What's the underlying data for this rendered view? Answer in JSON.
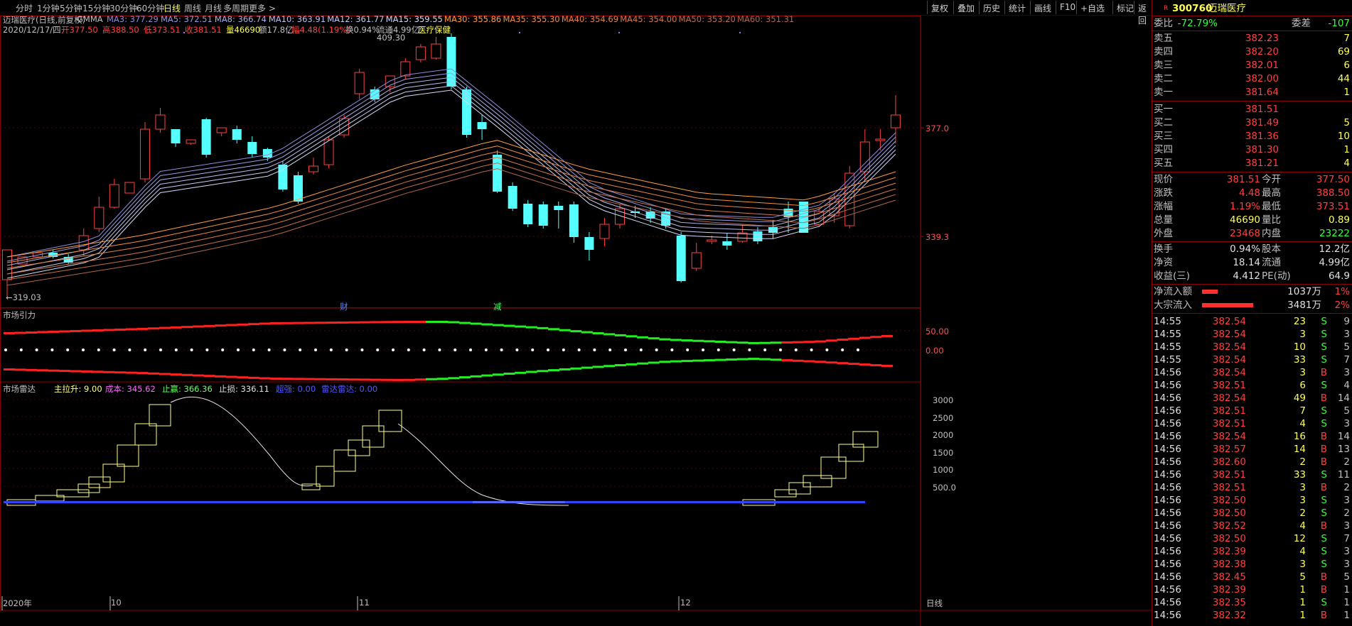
{
  "toolbar": {
    "timeframes": [
      "分时",
      "1分钟",
      "5分钟",
      "15分钟",
      "30分钟",
      "60分钟",
      "日线",
      "周线",
      "月线",
      "多周期",
      "更多 >"
    ],
    "active_timeframe": "日线",
    "right_buttons": [
      "复权",
      "叠加",
      "历史",
      "统计",
      "画线",
      "F10",
      "+自选",
      "标记",
      "返回"
    ]
  },
  "kline": {
    "title": "迈瑞医疗(日线,前复权)",
    "gmma_label": "GMMA",
    "ma": [
      {
        "label": "MA3: 377.29",
        "color": "#8b8bd8"
      },
      {
        "label": "MA5: 372.51",
        "color": "#9a9ae0"
      },
      {
        "label": "MA8: 366.74",
        "color": "#aab0e8"
      },
      {
        "label": "MA10: 363.91",
        "color": "#b8c0ee"
      },
      {
        "label": "MA12: 361.77",
        "color": "#c4ccf2"
      },
      {
        "label": "MA15: 359.55",
        "color": "#d4daf8"
      },
      {
        "label": "MA30: 355.86",
        "color": "#ff9e3d"
      },
      {
        "label": "MA35: 355.30",
        "color": "#f09040"
      },
      {
        "label": "MA40: 354.69",
        "color": "#e08545"
      },
      {
        "label": "MA45: 354.00",
        "color": "#d07a48"
      },
      {
        "label": "MA50: 353.20",
        "color": "#c0704a"
      },
      {
        "label": "MA60: 351.31",
        "color": "#b0664c"
      }
    ],
    "info": [
      {
        "t": "2020/12/17/四",
        "c": "#c0c0c0"
      },
      {
        "t": "开377.50",
        "c": "#ff4040"
      },
      {
        "t": "高388.50",
        "c": "#ff4040"
      },
      {
        "t": "低373.51",
        "c": "#ff4040"
      },
      {
        "t": "收381.51",
        "c": "#ff4040"
      },
      {
        "t": "量46690",
        "c": "#ffff55"
      },
      {
        "t": "额17.8亿",
        "c": "#c0c0c0"
      },
      {
        "t": "幅4.48(1.19%)",
        "c": "#ff4040"
      },
      {
        "t": "换0.94%",
        "c": "#c0c0c0"
      },
      {
        "t": "流通4.99亿",
        "c": "#c0c0c0"
      },
      {
        "t": "医疗保健",
        "c": "#ffff55"
      }
    ],
    "y_labels": [
      "377.0",
      "339.3"
    ],
    "high_mark": "409.30",
    "low_mark": "←319.03",
    "event_marks": [
      "财",
      "减"
    ],
    "x_labels": [
      "2020年",
      "10",
      "11",
      "12"
    ],
    "period_label": "日线"
  },
  "panel2": {
    "title": "市场引力",
    "y_labels": [
      "50.00",
      "0.00"
    ]
  },
  "panel3": {
    "title": "市场雷达",
    "legend": [
      {
        "t": "主拉升: 9.00",
        "c": "#ffff88"
      },
      {
        "t": "成本: 345.62",
        "c": "#ff66ff"
      },
      {
        "t": "止赢: 366.36",
        "c": "#66ff66"
      },
      {
        "t": "止损: 336.11",
        "c": "#e0e0e0"
      },
      {
        "t": "超强: 0.00",
        "c": "#5555ff"
      },
      {
        "t": "雷达雷达: 0.00",
        "c": "#5555ff"
      }
    ],
    "y_labels": [
      "3000",
      "2500",
      "2000",
      "1500",
      "1000",
      "500.0"
    ]
  },
  "quote": {
    "code": "300760",
    "name": "迈瑞医疗",
    "badge": "R",
    "weibi_label": "委比",
    "weibi": "-72.79%",
    "weicha_label": "委差",
    "weicha": "-107",
    "sells": [
      {
        "l": "卖五",
        "p": "382.23",
        "v": "7"
      },
      {
        "l": "卖四",
        "p": "382.20",
        "v": "69"
      },
      {
        "l": "卖三",
        "p": "382.01",
        "v": "6"
      },
      {
        "l": "卖二",
        "p": "382.00",
        "v": "44"
      },
      {
        "l": "卖一",
        "p": "381.64",
        "v": "1"
      }
    ],
    "buys": [
      {
        "l": "买一",
        "p": "381.51",
        "v": ""
      },
      {
        "l": "买二",
        "p": "381.49",
        "v": "5"
      },
      {
        "l": "买三",
        "p": "381.36",
        "v": "10"
      },
      {
        "l": "买四",
        "p": "381.30",
        "v": "1"
      },
      {
        "l": "买五",
        "p": "381.21",
        "v": "4"
      }
    ],
    "stats": [
      {
        "l1": "现价",
        "v1": "381.51",
        "c1": "#ff4040",
        "l2": "今开",
        "v2": "377.50",
        "c2": "#ff4040"
      },
      {
        "l1": "涨跌",
        "v1": "4.48",
        "c1": "#ff4040",
        "l2": "最高",
        "v2": "388.50",
        "c2": "#ff4040"
      },
      {
        "l1": "涨幅",
        "v1": "1.19%",
        "c1": "#ff4040",
        "l2": "最低",
        "v2": "373.51",
        "c2": "#ff4040"
      },
      {
        "l1": "总量",
        "v1": "46690",
        "c1": "#ffff55",
        "l2": "量比",
        "v2": "0.89",
        "c2": "#ffff55"
      },
      {
        "l1": "外盘",
        "v1": "23468",
        "c1": "#ff4040",
        "l2": "内盘",
        "v2": "23222",
        "c2": "#33ff33"
      }
    ],
    "stats2": [
      {
        "l1": "换手",
        "v1": "0.94%",
        "c1": "#e0e0e0",
        "l2": "股本",
        "v2": "12.2亿",
        "c2": "#e0e0e0"
      },
      {
        "l1": "净资",
        "v1": "18.14",
        "c1": "#e0e0e0",
        "l2": "流通",
        "v2": "4.99亿",
        "c2": "#e0e0e0"
      },
      {
        "l1": "收益(三)",
        "v1": "4.412",
        "c1": "#e0e0e0",
        "l2": "PE(动)",
        "v2": "64.9",
        "c2": "#e0e0e0"
      }
    ],
    "flows": [
      {
        "l": "净流入额",
        "v": "1037万",
        "p": "1%",
        "bar": 0.18
      },
      {
        "l": "大宗流入",
        "v": "3481万",
        "p": "2%",
        "bar": 0.6
      }
    ],
    "ticks": [
      {
        "t": "14:55",
        "p": "382.54",
        "v": "23",
        "d": "S",
        "n": "9"
      },
      {
        "t": "14:55",
        "p": "382.54",
        "v": "3",
        "d": "S",
        "n": "3"
      },
      {
        "t": "14:55",
        "p": "382.54",
        "v": "10",
        "d": "S",
        "n": "5"
      },
      {
        "t": "14:55",
        "p": "382.54",
        "v": "33",
        "d": "S",
        "n": "7"
      },
      {
        "t": "14:56",
        "p": "382.54",
        "v": "3",
        "d": "B",
        "n": "3"
      },
      {
        "t": "14:56",
        "p": "382.51",
        "v": "6",
        "d": "S",
        "n": "4"
      },
      {
        "t": "14:56",
        "p": "382.54",
        "v": "49",
        "d": "B",
        "n": "14"
      },
      {
        "t": "14:56",
        "p": "382.51",
        "v": "7",
        "d": "S",
        "n": "5"
      },
      {
        "t": "14:56",
        "p": "382.51",
        "v": "4",
        "d": "S",
        "n": "3"
      },
      {
        "t": "14:56",
        "p": "382.54",
        "v": "16",
        "d": "B",
        "n": "14"
      },
      {
        "t": "14:56",
        "p": "382.57",
        "v": "14",
        "d": "B",
        "n": "13"
      },
      {
        "t": "14:56",
        "p": "382.60",
        "v": "2",
        "d": "B",
        "n": "2"
      },
      {
        "t": "14:56",
        "p": "382.51",
        "v": "33",
        "d": "S",
        "n": "11"
      },
      {
        "t": "14:56",
        "p": "382.51",
        "v": "3",
        "d": "B",
        "n": "2"
      },
      {
        "t": "14:56",
        "p": "382.50",
        "v": "3",
        "d": "S",
        "n": "3"
      },
      {
        "t": "14:56",
        "p": "382.50",
        "v": "2",
        "d": "S",
        "n": "2"
      },
      {
        "t": "14:56",
        "p": "382.52",
        "v": "4",
        "d": "B",
        "n": "3"
      },
      {
        "t": "14:56",
        "p": "382.50",
        "v": "12",
        "d": "S",
        "n": "7"
      },
      {
        "t": "14:56",
        "p": "382.39",
        "v": "4",
        "d": "S",
        "n": "3"
      },
      {
        "t": "14:56",
        "p": "382.38",
        "v": "3",
        "d": "S",
        "n": "3"
      },
      {
        "t": "14:56",
        "p": "382.45",
        "v": "5",
        "d": "B",
        "n": "5"
      },
      {
        "t": "14:56",
        "p": "382.39",
        "v": "1",
        "d": "B",
        "n": "1"
      },
      {
        "t": "14:56",
        "p": "382.35",
        "v": "1",
        "d": "S",
        "n": "1"
      },
      {
        "t": "14:56",
        "p": "382.32",
        "v": "1",
        "d": "B",
        "n": "1"
      }
    ]
  }
}
